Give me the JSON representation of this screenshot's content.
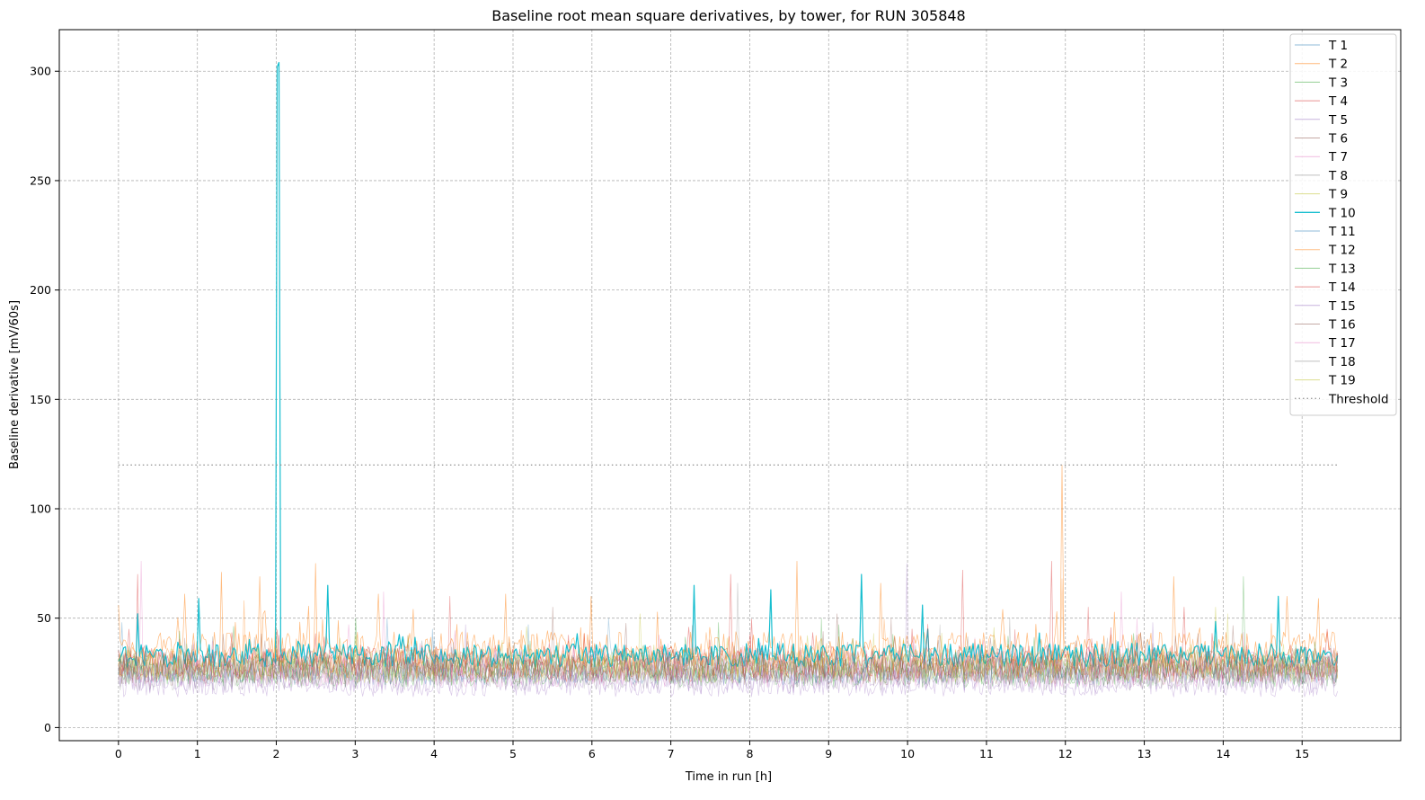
{
  "chart_data": {
    "type": "line",
    "title": "Baseline root mean square derivatives, by tower, for RUN 305848",
    "xlabel": "Time in run [h]",
    "ylabel": "Baseline derivative [mV/60s]",
    "xlim": [
      -0.75,
      16.25
    ],
    "ylim": [
      -6,
      319
    ],
    "xticks": [
      0,
      1,
      2,
      3,
      4,
      5,
      6,
      7,
      8,
      9,
      10,
      11,
      12,
      13,
      14,
      15
    ],
    "yticks": [
      0,
      50,
      100,
      150,
      200,
      250,
      300
    ],
    "grid": true,
    "legend_position": "top-right",
    "x_end": 15.45,
    "n_points": 700,
    "series": [
      {
        "name": "T 1",
        "color": "#1f77b4",
        "opacity": 0.35,
        "width": 0.7,
        "base": 26,
        "amp": 11,
        "spikes": [
          [
            0.05,
            48
          ],
          [
            3.4,
            50
          ],
          [
            5.2,
            47
          ]
        ]
      },
      {
        "name": "T 2",
        "color": "#ff7f0e",
        "opacity": 0.55,
        "width": 0.7,
        "base": 36,
        "amp": 13,
        "spikes": [
          [
            0.0,
            56
          ],
          [
            0.85,
            61
          ],
          [
            1.3,
            71
          ],
          [
            1.8,
            69
          ],
          [
            2.5,
            75
          ],
          [
            3.3,
            61
          ],
          [
            4.9,
            61
          ],
          [
            6.0,
            60
          ],
          [
            8.6,
            76
          ],
          [
            9.65,
            66
          ],
          [
            11.2,
            54
          ],
          [
            11.95,
            120
          ],
          [
            13.38,
            69
          ],
          [
            14.8,
            60
          ],
          [
            15.2,
            59
          ]
        ]
      },
      {
        "name": "T 3",
        "color": "#2ca02c",
        "opacity": 0.4,
        "width": 0.7,
        "base": 27,
        "amp": 12,
        "spikes": [
          [
            14.25,
            69
          ],
          [
            3.0,
            50
          ],
          [
            7.6,
            48
          ]
        ]
      },
      {
        "name": "T 4",
        "color": "#d62728",
        "opacity": 0.45,
        "width": 0.7,
        "base": 30,
        "amp": 13,
        "spikes": [
          [
            0.25,
            70
          ],
          [
            7.75,
            70
          ],
          [
            10.7,
            72
          ],
          [
            11.82,
            76
          ],
          [
            13.5,
            55
          ]
        ]
      },
      {
        "name": "T 5",
        "color": "#9467bd",
        "opacity": 0.35,
        "width": 0.7,
        "base": 22,
        "amp": 11,
        "spikes": [
          [
            10.0,
            75
          ],
          [
            4.4,
            47
          ]
        ]
      },
      {
        "name": "T 6",
        "color": "#8c564b",
        "opacity": 0.4,
        "width": 0.7,
        "base": 29,
        "amp": 12,
        "spikes": [
          [
            5.5,
            55
          ],
          [
            9.1,
            52
          ]
        ]
      },
      {
        "name": "T 7",
        "color": "#e377c2",
        "opacity": 0.4,
        "width": 0.7,
        "base": 28,
        "amp": 12,
        "spikes": [
          [
            0.28,
            76
          ],
          [
            3.35,
            62
          ],
          [
            12.7,
            62
          ]
        ]
      },
      {
        "name": "T 8",
        "color": "#7f7f7f",
        "opacity": 0.35,
        "width": 0.7,
        "base": 26,
        "amp": 11,
        "spikes": [
          [
            7.85,
            66
          ],
          [
            11.3,
            50
          ]
        ]
      },
      {
        "name": "T 9",
        "color": "#bcbd22",
        "opacity": 0.4,
        "width": 0.7,
        "base": 29,
        "amp": 12,
        "spikes": [
          [
            6.6,
            52
          ],
          [
            13.9,
            55
          ]
        ]
      },
      {
        "name": "T 10",
        "color": "#17becf",
        "opacity": 1.0,
        "width": 1.2,
        "base": 33,
        "amp": 9,
        "spikes": [
          [
            0.25,
            52
          ],
          [
            1.02,
            59
          ],
          [
            2.02,
            302
          ],
          [
            2.04,
            304
          ],
          [
            2.65,
            65
          ],
          [
            7.3,
            65
          ],
          [
            8.27,
            63
          ],
          [
            9.42,
            70
          ],
          [
            10.2,
            56
          ],
          [
            14.7,
            60
          ]
        ]
      },
      {
        "name": "T 11",
        "color": "#1f77b4",
        "opacity": 0.3,
        "width": 0.7,
        "base": 27,
        "amp": 11,
        "spikes": [
          [
            6.2,
            50
          ]
        ]
      },
      {
        "name": "T 12",
        "color": "#ff7f0e",
        "opacity": 0.4,
        "width": 0.7,
        "base": 30,
        "amp": 12,
        "spikes": [
          [
            1.6,
            58
          ],
          [
            11.95,
            68
          ]
        ]
      },
      {
        "name": "T 13",
        "color": "#2ca02c",
        "opacity": 0.35,
        "width": 0.7,
        "base": 25,
        "amp": 11,
        "spikes": [
          [
            8.9,
            50
          ]
        ]
      },
      {
        "name": "T 14",
        "color": "#d62728",
        "opacity": 0.4,
        "width": 0.7,
        "base": 28,
        "amp": 12,
        "spikes": [
          [
            12.3,
            55
          ],
          [
            4.2,
            60
          ]
        ]
      },
      {
        "name": "T 15",
        "color": "#9467bd",
        "opacity": 0.35,
        "width": 0.7,
        "base": 20,
        "amp": 10,
        "spikes": [
          [
            13.1,
            48
          ]
        ]
      },
      {
        "name": "T 16",
        "color": "#8c564b",
        "opacity": 0.35,
        "width": 0.7,
        "base": 26,
        "amp": 11,
        "spikes": [
          [
            9.8,
            50
          ]
        ]
      },
      {
        "name": "T 17",
        "color": "#e377c2",
        "opacity": 0.35,
        "width": 0.7,
        "base": 25,
        "amp": 11,
        "spikes": [
          [
            12.9,
            50
          ]
        ]
      },
      {
        "name": "T 18",
        "color": "#7f7f7f",
        "opacity": 0.3,
        "width": 0.7,
        "base": 23,
        "amp": 10,
        "spikes": [
          [
            10.4,
            47
          ]
        ]
      },
      {
        "name": "T 19",
        "color": "#bcbd22",
        "opacity": 0.35,
        "width": 0.7,
        "base": 27,
        "amp": 11,
        "spikes": [
          [
            14.05,
            52
          ]
        ]
      }
    ],
    "threshold": {
      "name": "Threshold",
      "value": 120,
      "x": [
        0,
        15.45
      ],
      "color": "#999999"
    }
  }
}
